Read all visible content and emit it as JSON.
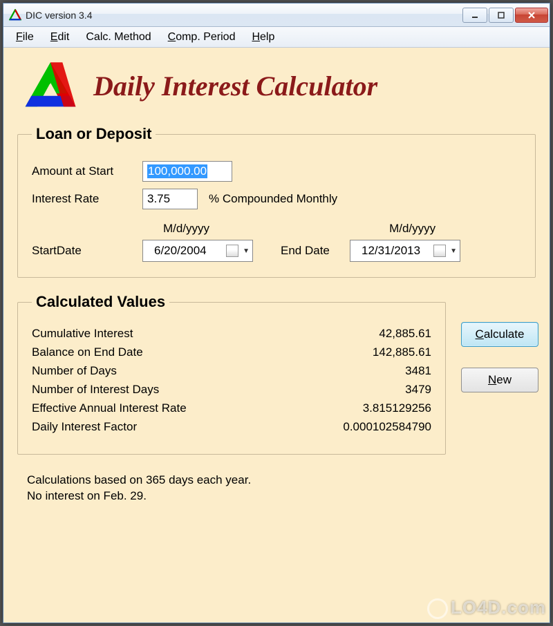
{
  "window": {
    "title": "DIC version 3.4"
  },
  "menu": {
    "file": "File",
    "edit": "Edit",
    "calc_method": "Calc. Method",
    "comp_period": "Comp. Period",
    "help": "Help"
  },
  "header": {
    "title": "Daily Interest Calculator"
  },
  "loan": {
    "legend": "Loan or Deposit",
    "amount_label": "Amount at Start",
    "amount_value": "100,000.00",
    "rate_label": "Interest Rate",
    "rate_value": "3.75",
    "rate_suffix": "% Compounded Monthly",
    "date_format_hint": "M/d/yyyy",
    "start_date_label": "StartDate",
    "start_date_value": "6/20/2004",
    "end_date_label": "End Date",
    "end_date_value": "12/31/2013"
  },
  "results": {
    "legend": "Calculated Values",
    "rows": [
      {
        "label": "Cumulative Interest",
        "value": "42,885.61"
      },
      {
        "label": "Balance on End Date",
        "value": "142,885.61"
      },
      {
        "label": "Number of Days",
        "value": "3481"
      },
      {
        "label": "Number of Interest Days",
        "value": "3479"
      },
      {
        "label": "Effective Annual Interest Rate",
        "value": "3.815129256"
      },
      {
        "label": "Daily Interest Factor",
        "value": "0.000102584790"
      }
    ]
  },
  "buttons": {
    "calculate": "Calculate",
    "new": "New"
  },
  "footer": {
    "line1": "Calculations based on 365 days each year.",
    "line2": "No interest on Feb. 29."
  },
  "watermark": "LO4D.com"
}
